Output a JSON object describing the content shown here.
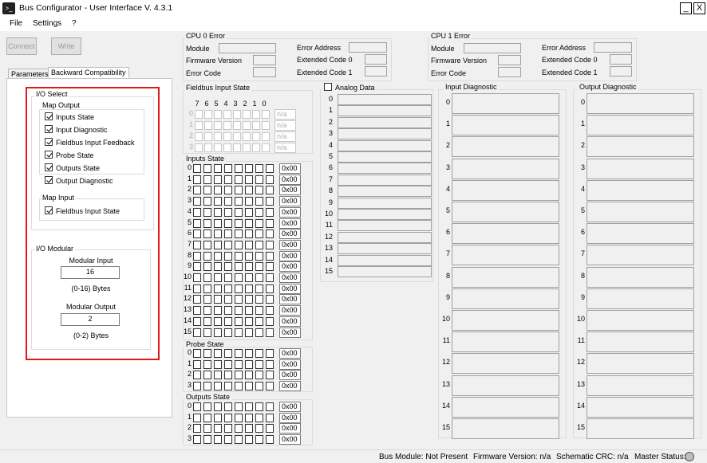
{
  "window": {
    "title": "Bus Configurator - User Interface  V. 4.3.1",
    "app_icon": "terminal-icon",
    "min_glyph": "_",
    "close_glyph": "X"
  },
  "menu": [
    "File",
    "Settings",
    "?"
  ],
  "toolbar": {
    "connect_label": "Connect",
    "write_label": "Write"
  },
  "tabs": [
    "Parameters",
    "Backward Compatibility"
  ],
  "io_select": {
    "title": "I/O Select",
    "map_output": {
      "title": "Map Output",
      "items": [
        {
          "label": "Inputs State",
          "checked": true
        },
        {
          "label": "Input Diagnostic",
          "checked": true
        },
        {
          "label": "Fieldbus Input Feedback",
          "checked": true
        },
        {
          "label": "Probe State",
          "checked": true
        },
        {
          "label": "Outputs State",
          "checked": true
        },
        {
          "label": "Output Diagnostic",
          "checked": true
        }
      ]
    },
    "map_input": {
      "title": "Map Input",
      "items": [
        {
          "label": "Fieldbus Input State",
          "checked": true
        }
      ]
    }
  },
  "io_modular": {
    "title": "I/O Modular",
    "input_label": "Modular Input",
    "input_value": "16",
    "input_range": "(0-16) Bytes",
    "output_label": "Modular Output",
    "output_value": "2",
    "output_range": "(0-2) Bytes"
  },
  "cpu0": {
    "title": "CPU 0 Error",
    "labels": [
      "Module",
      "Firmware Version",
      "Error Code",
      "Error Address",
      "Extended Code 0",
      "Extended Code 1"
    ]
  },
  "cpu1": {
    "title": "CPU 1 Error",
    "labels": [
      "Module",
      "Firmware Version",
      "Error Code",
      "Error Address",
      "Extended Code 0",
      "Extended Code 1"
    ]
  },
  "fieldbus": {
    "title": "Fieldbus Input State",
    "bits": [
      "7",
      "6",
      "5",
      "4",
      "3",
      "2",
      "1",
      "0"
    ],
    "rows": [
      "0",
      "1",
      "2",
      "3"
    ],
    "value": "n/a"
  },
  "inputs_state": {
    "title": "Inputs State",
    "rows": [
      "0",
      "1",
      "2",
      "3",
      "4",
      "5",
      "6",
      "7",
      "8",
      "9",
      "10",
      "11",
      "12",
      "13",
      "14",
      "15"
    ],
    "value": "0x00"
  },
  "probe_state": {
    "title": "Probe State",
    "rows": [
      "0",
      "1",
      "2",
      "3"
    ],
    "value": "0x00"
  },
  "outputs_state": {
    "title": "Outputs State",
    "rows": [
      "0",
      "1",
      "2",
      "3"
    ],
    "value": "0x00"
  },
  "analog": {
    "label": "Analog Data",
    "checked": false,
    "rows": [
      "0",
      "1",
      "2",
      "3",
      "4",
      "5",
      "6",
      "7",
      "8",
      "9",
      "10",
      "11",
      "12",
      "13",
      "14",
      "15"
    ]
  },
  "input_diag": {
    "title": "Input Diagnostic",
    "rows": [
      "0",
      "1",
      "2",
      "3",
      "4",
      "5",
      "6",
      "7",
      "8",
      "9",
      "10",
      "11",
      "12",
      "13",
      "14",
      "15"
    ]
  },
  "output_diag": {
    "title": "Output Diagnostic",
    "rows": [
      "0",
      "1",
      "2",
      "3",
      "4",
      "5",
      "6",
      "7",
      "8",
      "9",
      "10",
      "11",
      "12",
      "13",
      "14",
      "15"
    ]
  },
  "status": {
    "bus_module": "Bus Module: Not Present",
    "firmware": "Firmware Version: n/a",
    "crc": "Schematic CRC: n/a",
    "master": "Master Status:"
  }
}
